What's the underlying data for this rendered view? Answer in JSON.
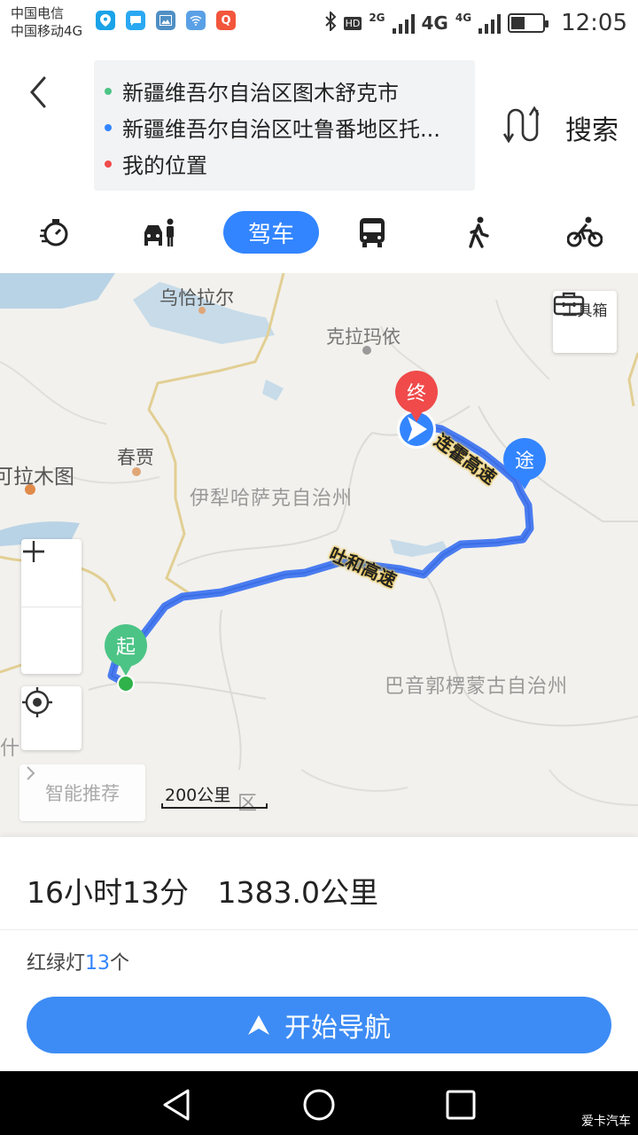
{
  "status_bar": {
    "carrier1": "中国电信",
    "carrier2": "中国移动4G",
    "net1": "2G",
    "net2": "4G",
    "net3": "4G",
    "hd": "HD",
    "time": "12:05",
    "battery_level": 0.45,
    "notif_icons": [
      "location-icon",
      "chat-icon",
      "gallery-icon",
      "wifi-icon",
      "q-app-icon"
    ]
  },
  "route": {
    "start": "新疆维吾尔自治区图木舒克市",
    "via": "新疆维吾尔自治区吐鲁番地区托...",
    "end": "我的位置",
    "start_color": "#4cc486",
    "via_color": "#3385ff",
    "end_color": "#f04a4a"
  },
  "header": {
    "search_label": "搜索"
  },
  "modes": {
    "items": [
      "timer-icon",
      "taxi-icon",
      "驾车",
      "bus-icon",
      "walk-icon",
      "bike-icon"
    ],
    "active": "驾车"
  },
  "map": {
    "labels": {
      "wuqialaer": "乌恰拉尔",
      "kelamayi": "克拉玛依",
      "chungong": "春贾",
      "alamutu": "可拉木图",
      "yili": "伊犁哈萨克自治州",
      "bayin": "巴音郭楞蒙古自治州",
      "shi": "什",
      "district": "区"
    },
    "roads": {
      "lianhuo": "连霍高速",
      "tuhe": "吐和高速"
    },
    "pins": {
      "start": "起",
      "end": "终",
      "via": "途"
    },
    "toolbox": "工具箱",
    "smart_recommend": "智能推荐",
    "scale": "200公里",
    "colors": {
      "route": "#4a7cf0",
      "start_pin": "#4cc486",
      "end_pin": "#f04a4a",
      "via_pin": "#3385ff"
    }
  },
  "summary": {
    "duration": "16小时13分",
    "distance": "1383.0公里",
    "lights_prefix": "红绿灯",
    "lights_count": "13",
    "lights_suffix": "个"
  },
  "nav_button": "开始导航",
  "watermark": "爱卡汽车"
}
